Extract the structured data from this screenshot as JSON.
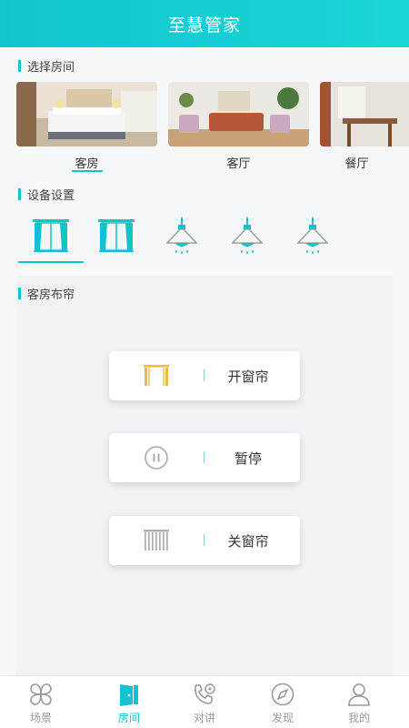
{
  "header": {
    "title": "至慧管家"
  },
  "rooms_section": {
    "title": "选择房间"
  },
  "rooms": [
    {
      "name": "客房",
      "selected": true
    },
    {
      "name": "客厅",
      "selected": false
    },
    {
      "name": "餐厅",
      "selected": false
    }
  ],
  "devices_section": {
    "title": "设备设置"
  },
  "devices": [
    {
      "icon": "curtain-icon",
      "selected": true
    },
    {
      "icon": "curtain-icon",
      "selected": false
    },
    {
      "icon": "pendant-lamp-icon",
      "selected": false
    },
    {
      "icon": "pendant-lamp-icon",
      "selected": false
    },
    {
      "icon": "pendant-lamp-icon",
      "selected": false
    }
  ],
  "panel": {
    "title": "客房布帘",
    "controls": [
      {
        "icon": "curtain-open-icon",
        "label": "开窗帘"
      },
      {
        "icon": "pause-icon",
        "label": "暂停"
      },
      {
        "icon": "curtain-closed-icon",
        "label": "关窗帘"
      }
    ]
  },
  "tabbar": [
    {
      "icon": "scene-icon",
      "label": "场景",
      "active": false
    },
    {
      "icon": "room-door-icon",
      "label": "房间",
      "active": true
    },
    {
      "icon": "intercom-phone-icon",
      "label": "对讲",
      "active": false
    },
    {
      "icon": "compass-icon",
      "label": "发现",
      "active": false
    },
    {
      "icon": "user-icon",
      "label": "我的",
      "active": false
    }
  ],
  "colors": {
    "accent": "#12c3cf",
    "curtain_open": "#e8b84a",
    "inactive": "#999999"
  }
}
